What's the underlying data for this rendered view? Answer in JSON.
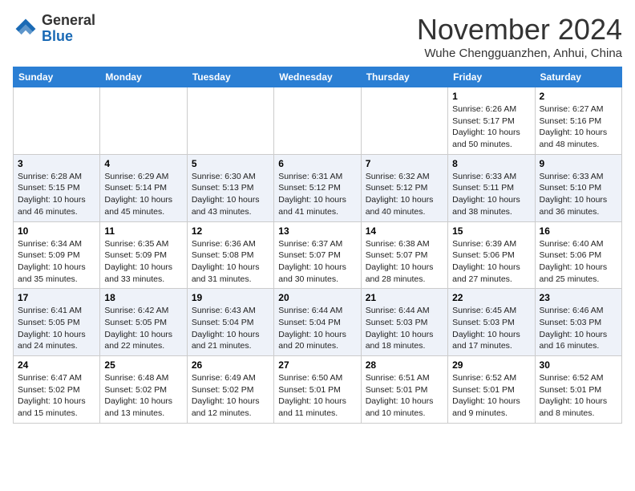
{
  "header": {
    "logo": {
      "general": "General",
      "blue": "Blue"
    },
    "title": "November 2024",
    "location": "Wuhe Chengguanzhen, Anhui, China"
  },
  "weekdays": [
    "Sunday",
    "Monday",
    "Tuesday",
    "Wednesday",
    "Thursday",
    "Friday",
    "Saturday"
  ],
  "weeks": [
    [
      {
        "day": "",
        "info": ""
      },
      {
        "day": "",
        "info": ""
      },
      {
        "day": "",
        "info": ""
      },
      {
        "day": "",
        "info": ""
      },
      {
        "day": "",
        "info": ""
      },
      {
        "day": "1",
        "info": "Sunrise: 6:26 AM\nSunset: 5:17 PM\nDaylight: 10 hours\nand 50 minutes."
      },
      {
        "day": "2",
        "info": "Sunrise: 6:27 AM\nSunset: 5:16 PM\nDaylight: 10 hours\nand 48 minutes."
      }
    ],
    [
      {
        "day": "3",
        "info": "Sunrise: 6:28 AM\nSunset: 5:15 PM\nDaylight: 10 hours\nand 46 minutes."
      },
      {
        "day": "4",
        "info": "Sunrise: 6:29 AM\nSunset: 5:14 PM\nDaylight: 10 hours\nand 45 minutes."
      },
      {
        "day": "5",
        "info": "Sunrise: 6:30 AM\nSunset: 5:13 PM\nDaylight: 10 hours\nand 43 minutes."
      },
      {
        "day": "6",
        "info": "Sunrise: 6:31 AM\nSunset: 5:12 PM\nDaylight: 10 hours\nand 41 minutes."
      },
      {
        "day": "7",
        "info": "Sunrise: 6:32 AM\nSunset: 5:12 PM\nDaylight: 10 hours\nand 40 minutes."
      },
      {
        "day": "8",
        "info": "Sunrise: 6:33 AM\nSunset: 5:11 PM\nDaylight: 10 hours\nand 38 minutes."
      },
      {
        "day": "9",
        "info": "Sunrise: 6:33 AM\nSunset: 5:10 PM\nDaylight: 10 hours\nand 36 minutes."
      }
    ],
    [
      {
        "day": "10",
        "info": "Sunrise: 6:34 AM\nSunset: 5:09 PM\nDaylight: 10 hours\nand 35 minutes."
      },
      {
        "day": "11",
        "info": "Sunrise: 6:35 AM\nSunset: 5:09 PM\nDaylight: 10 hours\nand 33 minutes."
      },
      {
        "day": "12",
        "info": "Sunrise: 6:36 AM\nSunset: 5:08 PM\nDaylight: 10 hours\nand 31 minutes."
      },
      {
        "day": "13",
        "info": "Sunrise: 6:37 AM\nSunset: 5:07 PM\nDaylight: 10 hours\nand 30 minutes."
      },
      {
        "day": "14",
        "info": "Sunrise: 6:38 AM\nSunset: 5:07 PM\nDaylight: 10 hours\nand 28 minutes."
      },
      {
        "day": "15",
        "info": "Sunrise: 6:39 AM\nSunset: 5:06 PM\nDaylight: 10 hours\nand 27 minutes."
      },
      {
        "day": "16",
        "info": "Sunrise: 6:40 AM\nSunset: 5:06 PM\nDaylight: 10 hours\nand 25 minutes."
      }
    ],
    [
      {
        "day": "17",
        "info": "Sunrise: 6:41 AM\nSunset: 5:05 PM\nDaylight: 10 hours\nand 24 minutes."
      },
      {
        "day": "18",
        "info": "Sunrise: 6:42 AM\nSunset: 5:05 PM\nDaylight: 10 hours\nand 22 minutes."
      },
      {
        "day": "19",
        "info": "Sunrise: 6:43 AM\nSunset: 5:04 PM\nDaylight: 10 hours\nand 21 minutes."
      },
      {
        "day": "20",
        "info": "Sunrise: 6:44 AM\nSunset: 5:04 PM\nDaylight: 10 hours\nand 20 minutes."
      },
      {
        "day": "21",
        "info": "Sunrise: 6:44 AM\nSunset: 5:03 PM\nDaylight: 10 hours\nand 18 minutes."
      },
      {
        "day": "22",
        "info": "Sunrise: 6:45 AM\nSunset: 5:03 PM\nDaylight: 10 hours\nand 17 minutes."
      },
      {
        "day": "23",
        "info": "Sunrise: 6:46 AM\nSunset: 5:03 PM\nDaylight: 10 hours\nand 16 minutes."
      }
    ],
    [
      {
        "day": "24",
        "info": "Sunrise: 6:47 AM\nSunset: 5:02 PM\nDaylight: 10 hours\nand 15 minutes."
      },
      {
        "day": "25",
        "info": "Sunrise: 6:48 AM\nSunset: 5:02 PM\nDaylight: 10 hours\nand 13 minutes."
      },
      {
        "day": "26",
        "info": "Sunrise: 6:49 AM\nSunset: 5:02 PM\nDaylight: 10 hours\nand 12 minutes."
      },
      {
        "day": "27",
        "info": "Sunrise: 6:50 AM\nSunset: 5:01 PM\nDaylight: 10 hours\nand 11 minutes."
      },
      {
        "day": "28",
        "info": "Sunrise: 6:51 AM\nSunset: 5:01 PM\nDaylight: 10 hours\nand 10 minutes."
      },
      {
        "day": "29",
        "info": "Sunrise: 6:52 AM\nSunset: 5:01 PM\nDaylight: 10 hours\nand 9 minutes."
      },
      {
        "day": "30",
        "info": "Sunrise: 6:52 AM\nSunset: 5:01 PM\nDaylight: 10 hours\nand 8 minutes."
      }
    ]
  ]
}
